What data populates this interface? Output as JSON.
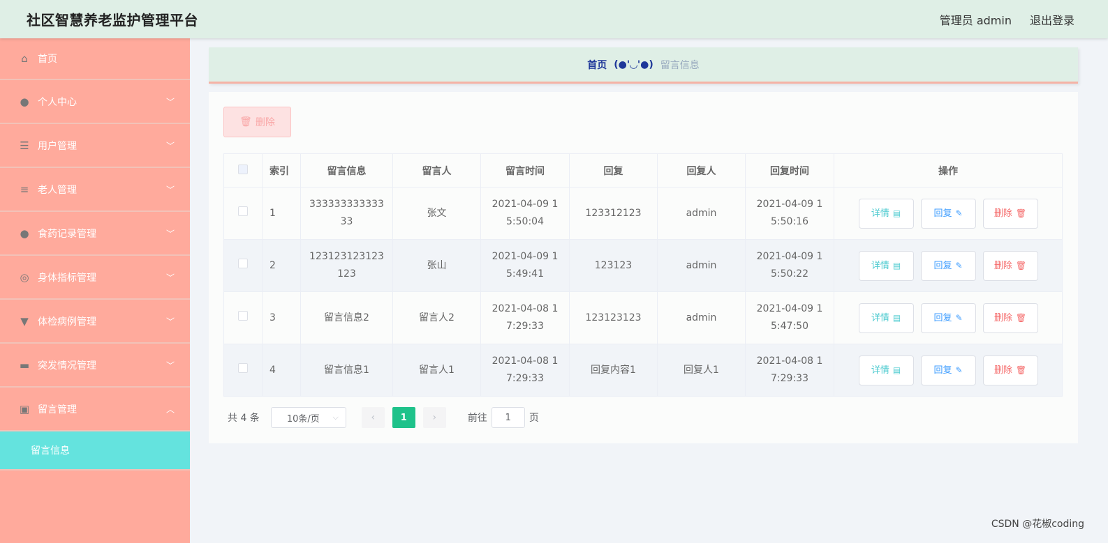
{
  "header": {
    "title": "社区智慧养老监护管理平台",
    "user": "管理员 admin",
    "logout": "退出登录"
  },
  "sidebar": {
    "items": [
      {
        "label": "首页",
        "icon": "home-icon",
        "glyph": "⌂"
      },
      {
        "label": "个人中心",
        "icon": "user-icon",
        "glyph": "●"
      },
      {
        "label": "用户管理",
        "icon": "sliders-icon",
        "glyph": "☰"
      },
      {
        "label": "老人管理",
        "icon": "list-icon",
        "glyph": "≡"
      },
      {
        "label": "食药记录管理",
        "icon": "user-icon",
        "glyph": "●"
      },
      {
        "label": "身体指标管理",
        "icon": "lifebuoy-icon",
        "glyph": "◎"
      },
      {
        "label": "体检病例管理",
        "icon": "stamp-icon",
        "glyph": "▼"
      },
      {
        "label": "突发情况管理",
        "icon": "briefcase-icon",
        "glyph": "▬"
      },
      {
        "label": "留言管理",
        "icon": "clipboard-icon",
        "glyph": "▣"
      }
    ],
    "active_sub": "留言信息"
  },
  "breadcrumb": {
    "home": "首页",
    "sep": "(●'◡'●)",
    "current": "留言信息"
  },
  "toolbar": {
    "delete_label": "删除"
  },
  "table": {
    "headers": [
      "索引",
      "留言信息",
      "留言人",
      "留言时间",
      "回复",
      "回复人",
      "回复时间",
      "操作"
    ],
    "rows": [
      {
        "index": "1",
        "message": "333333333333 33",
        "author": "张文",
        "msg_time": "2021-04-09 1 5:50:04",
        "reply": "123312123",
        "replier": "admin",
        "reply_time": "2021-04-09 1 5:50:16"
      },
      {
        "index": "2",
        "message": "123123123123 123",
        "author": "张山",
        "msg_time": "2021-04-09 1 5:49:41",
        "reply": "123123",
        "replier": "admin",
        "reply_time": "2021-04-09 1 5:50:22"
      },
      {
        "index": "3",
        "message": "留言信息2",
        "author": "留言人2",
        "msg_time": "2021-04-08 1 7:29:33",
        "reply": "123123123",
        "replier": "admin",
        "reply_time": "2021-04-09 1 5:47:50"
      },
      {
        "index": "4",
        "message": "留言信息1",
        "author": "留言人1",
        "msg_time": "2021-04-08 1 7:29:33",
        "reply": "回复内容1",
        "replier": "回复人1",
        "reply_time": "2021-04-08 1 7:29:33"
      }
    ],
    "actions": {
      "detail": "详情",
      "reply": "回复",
      "delete": "删除"
    }
  },
  "pagination": {
    "total": "共 4 条",
    "page_size": "10条/页",
    "current_page": "1",
    "goto_prefix": "前往",
    "goto_value": "1",
    "goto_suffix": "页"
  },
  "watermark": "CSDN @花椒coding"
}
